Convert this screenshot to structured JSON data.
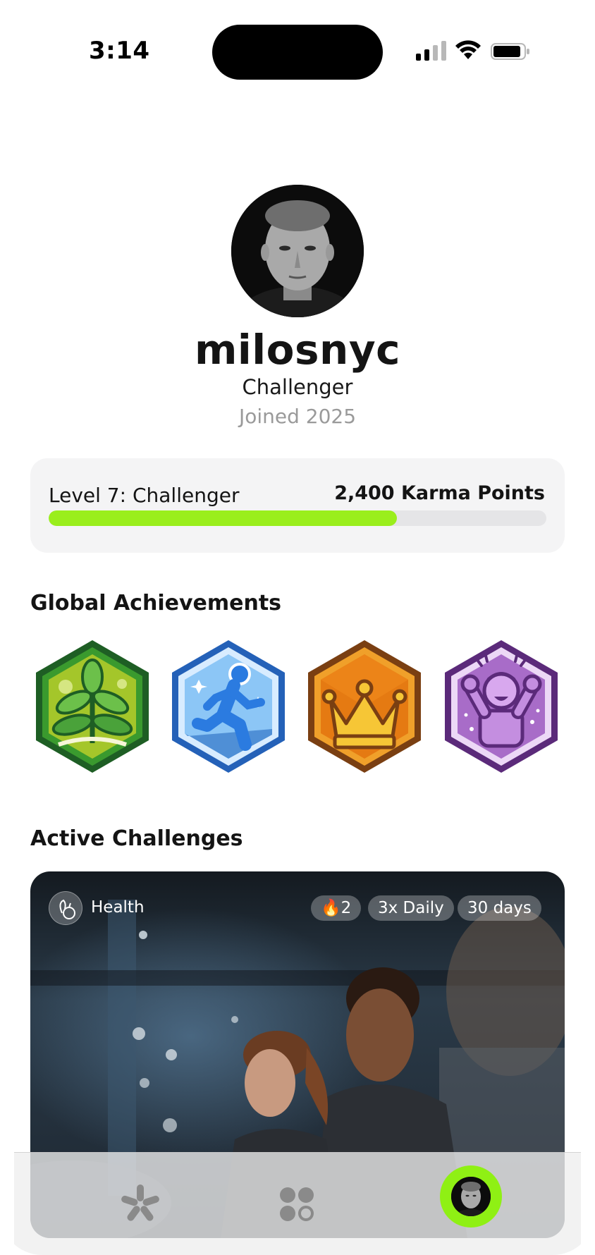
{
  "status_bar": {
    "time": "3:14",
    "icons": [
      "cellular-signal-icon",
      "wifi-icon",
      "battery-icon"
    ]
  },
  "profile": {
    "avatar": "profile-photo",
    "username": "milosnyc",
    "rank": "Challenger",
    "joined": "Joined 2025"
  },
  "level": {
    "label": "Level 7: Challenger",
    "karma": "2,400 Karma Points",
    "progress": 0.7,
    "progress_color": "#9aee1c"
  },
  "achievements": {
    "title": "Global Achievements",
    "badges": [
      {
        "icon": "sprout-badge-icon",
        "color": "#2e9b2e"
      },
      {
        "icon": "runner-badge-icon",
        "color": "#2f7fd8"
      },
      {
        "icon": "crown-badge-icon",
        "color": "#e8821a"
      },
      {
        "icon": "cheering-person-badge-icon",
        "color": "#7b3fa0"
      }
    ]
  },
  "challenges": {
    "title": "Active Challenges",
    "items": [
      {
        "category_icon": "health-icon",
        "category": "Health",
        "streak": "🔥2",
        "frequency": "3x Daily",
        "duration": "30 days"
      }
    ]
  },
  "nav": {
    "items": [
      "home-icon",
      "explore-icon",
      "profile-avatar"
    ],
    "accent": "#8ff014"
  }
}
